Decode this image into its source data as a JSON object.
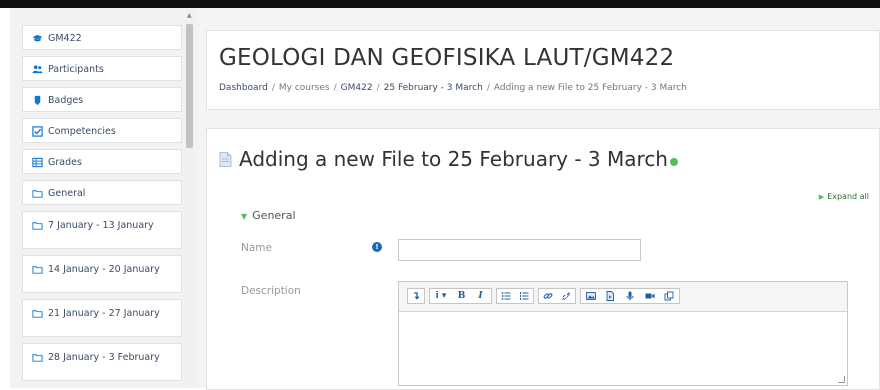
{
  "sidebar": {
    "items": [
      {
        "label": "GM422",
        "icon": "graduation-cap-icon"
      },
      {
        "label": "Participants",
        "icon": "users-icon"
      },
      {
        "label": "Badges",
        "icon": "badge-icon"
      },
      {
        "label": "Competencies",
        "icon": "checkbox-icon"
      },
      {
        "label": "Grades",
        "icon": "table-icon"
      },
      {
        "label": "General",
        "icon": "folder-icon"
      },
      {
        "label": "7 January - 13 January",
        "icon": "folder-icon"
      },
      {
        "label": "14 January - 20 January",
        "icon": "folder-icon"
      },
      {
        "label": "21 January - 27 January",
        "icon": "folder-icon"
      },
      {
        "label": "28 January - 3 February",
        "icon": "folder-icon"
      }
    ]
  },
  "header": {
    "title": "GEOLOGI DAN GEOFISIKA LAUT/GM422",
    "breadcrumb": [
      "Dashboard",
      "My courses",
      "GM422",
      "25 February - 3 March",
      "Adding a new File to 25 February - 3 March"
    ]
  },
  "form": {
    "heading": "Adding a new File to 25 February - 3 March",
    "expand_all": "Expand all",
    "section_general": "General",
    "name_label": "Name",
    "name_value": "",
    "description_label": "Description"
  },
  "colors": {
    "accent_blue": "#1177d1",
    "help_green": "#5cb85c",
    "required_blue": "#1a6bb8"
  }
}
